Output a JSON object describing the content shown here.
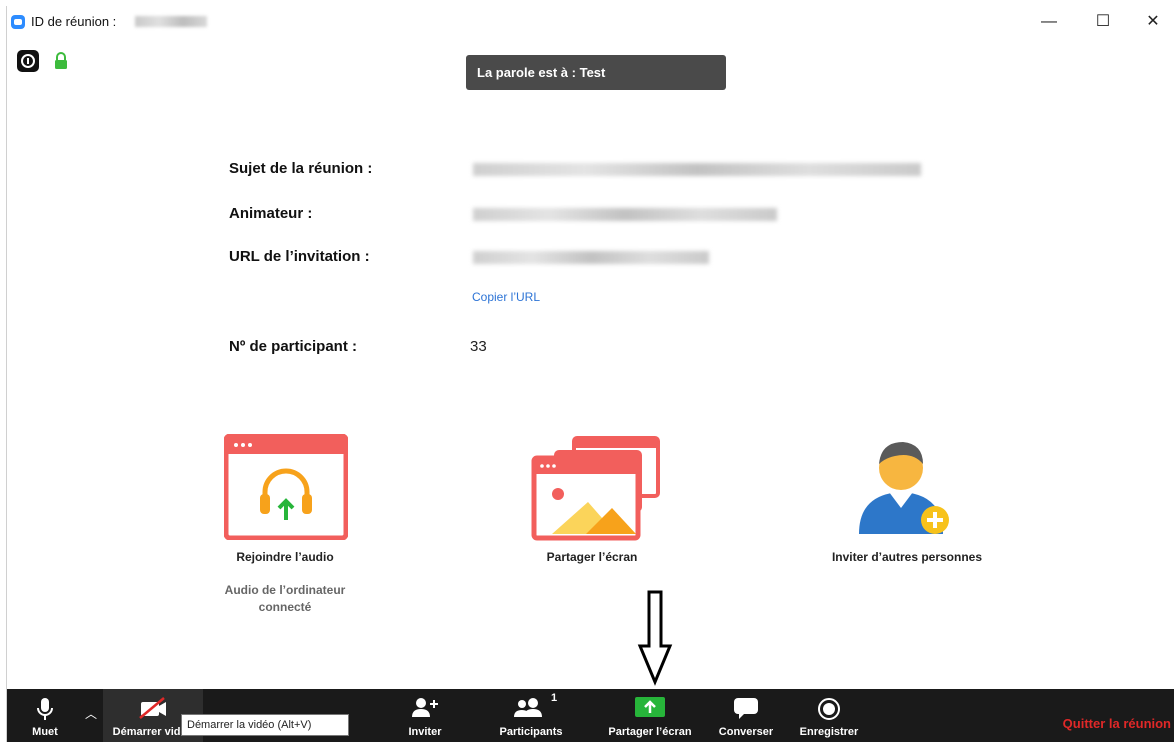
{
  "window": {
    "title_label": "ID de réunion :",
    "controls": {
      "minimize": "—",
      "maximize": "☐",
      "close": "✕"
    }
  },
  "speaker": {
    "text": "La parole est à : Test"
  },
  "meeting_info": {
    "topic_label": "Sujet de la réunion :",
    "host_label": "Animateur :",
    "invite_url_label": "URL de l’invitation :",
    "copy_url_link": "Copier l’URL",
    "participant_id_label": "Nº de participant :",
    "participant_id_value": "33"
  },
  "actions": {
    "join_audio": {
      "label": "Rejoindre l’audio",
      "sublabel_line1": "Audio de l’ordinateur",
      "sublabel_line2": "connecté"
    },
    "share_screen": {
      "label": "Partager l’écran"
    },
    "invite_others": {
      "label": "Inviter d’autres personnes"
    }
  },
  "toolbar": {
    "mute": "Muet",
    "start_video": "Démarrer vidéo",
    "invite": "Inviter",
    "participants": "Participants",
    "participants_count": "1",
    "share_screen": "Partager l’écran",
    "chat": "Converser",
    "record": "Enregistrer",
    "quit": "Quitter la réunion",
    "tooltip": "Démarrer la vidéo (Alt+V)"
  },
  "colors": {
    "accent_blue": "#2d8cff",
    "tile_red": "#f25f5c",
    "share_green": "#27b53a",
    "quit_red": "#e02828",
    "toolbar_bg": "#1a1a1a"
  }
}
